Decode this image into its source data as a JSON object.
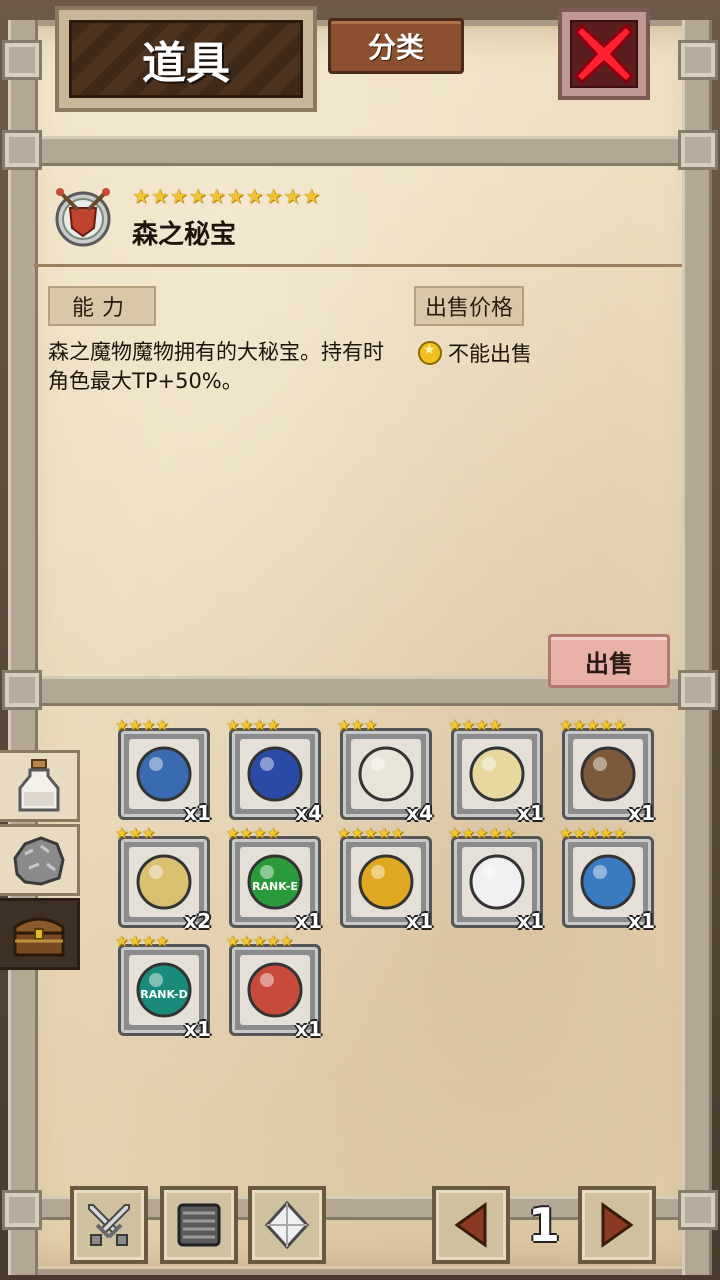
{
  "header": {
    "title": "道具",
    "category_label": "分类"
  },
  "selected_item": {
    "name": "森之秘宝",
    "stars": 10,
    "icon": "shield-emblem-icon",
    "ability_label": "能力",
    "description": "森之魔物魔物拥有的大秘宝。持有时角色最大TP+50%。",
    "price_label": "出售价格",
    "price_value": "不能出售",
    "sell_label": "出售"
  },
  "side_tabs": [
    {
      "icon": "potion-bottle-icon",
      "active": false
    },
    {
      "icon": "ore-rock-icon",
      "active": false
    },
    {
      "icon": "treasure-chest-icon",
      "active": true
    }
  ],
  "items": [
    {
      "icon": "dragon-eye-gem-icon",
      "stars": 4,
      "count": "x1",
      "color": "#3a6ab0"
    },
    {
      "icon": "blueprint-scroll-icon",
      "stars": 4,
      "count": "x4",
      "color": "#2a4aa8"
    },
    {
      "icon": "lucky-cat-icon",
      "stars": 3,
      "count": "x4",
      "color": "#e8e4d8"
    },
    {
      "icon": "ticket-icon",
      "stars": 4,
      "count": "x1",
      "color": "#e8d8a0"
    },
    {
      "icon": "dragon-wings-icon",
      "stars": 5,
      "count": "x1",
      "color": "#7a5a3a"
    },
    {
      "icon": "cheese-block-icon",
      "stars": 3,
      "count": "x2",
      "color": "#d8c070"
    },
    {
      "icon": "rank-e-badge-icon",
      "stars": 4,
      "count": "x1",
      "color": "#2a9a3a",
      "text": "RANK-E"
    },
    {
      "icon": "gold-medal-icon",
      "stars": 5,
      "count": "x1",
      "color": "#e0a820"
    },
    {
      "icon": "white-ticket-icon",
      "stars": 5,
      "count": "x1",
      "color": "#f0f0f0"
    },
    {
      "icon": "blue-crest-icon",
      "stars": 5,
      "count": "x1",
      "color": "#3a7ac0"
    },
    {
      "icon": "rank-d-badge-icon",
      "stars": 4,
      "count": "x1",
      "color": "#1a8a7a",
      "text": "RANK-D"
    },
    {
      "icon": "shield-emblem-icon",
      "stars": 5,
      "count": "x1",
      "color": "#c84a3a"
    }
  ],
  "bottom_bar": {
    "buttons": [
      "crossed-swords-icon",
      "armor-block-icon",
      "crystal-icon"
    ],
    "page": "1"
  }
}
